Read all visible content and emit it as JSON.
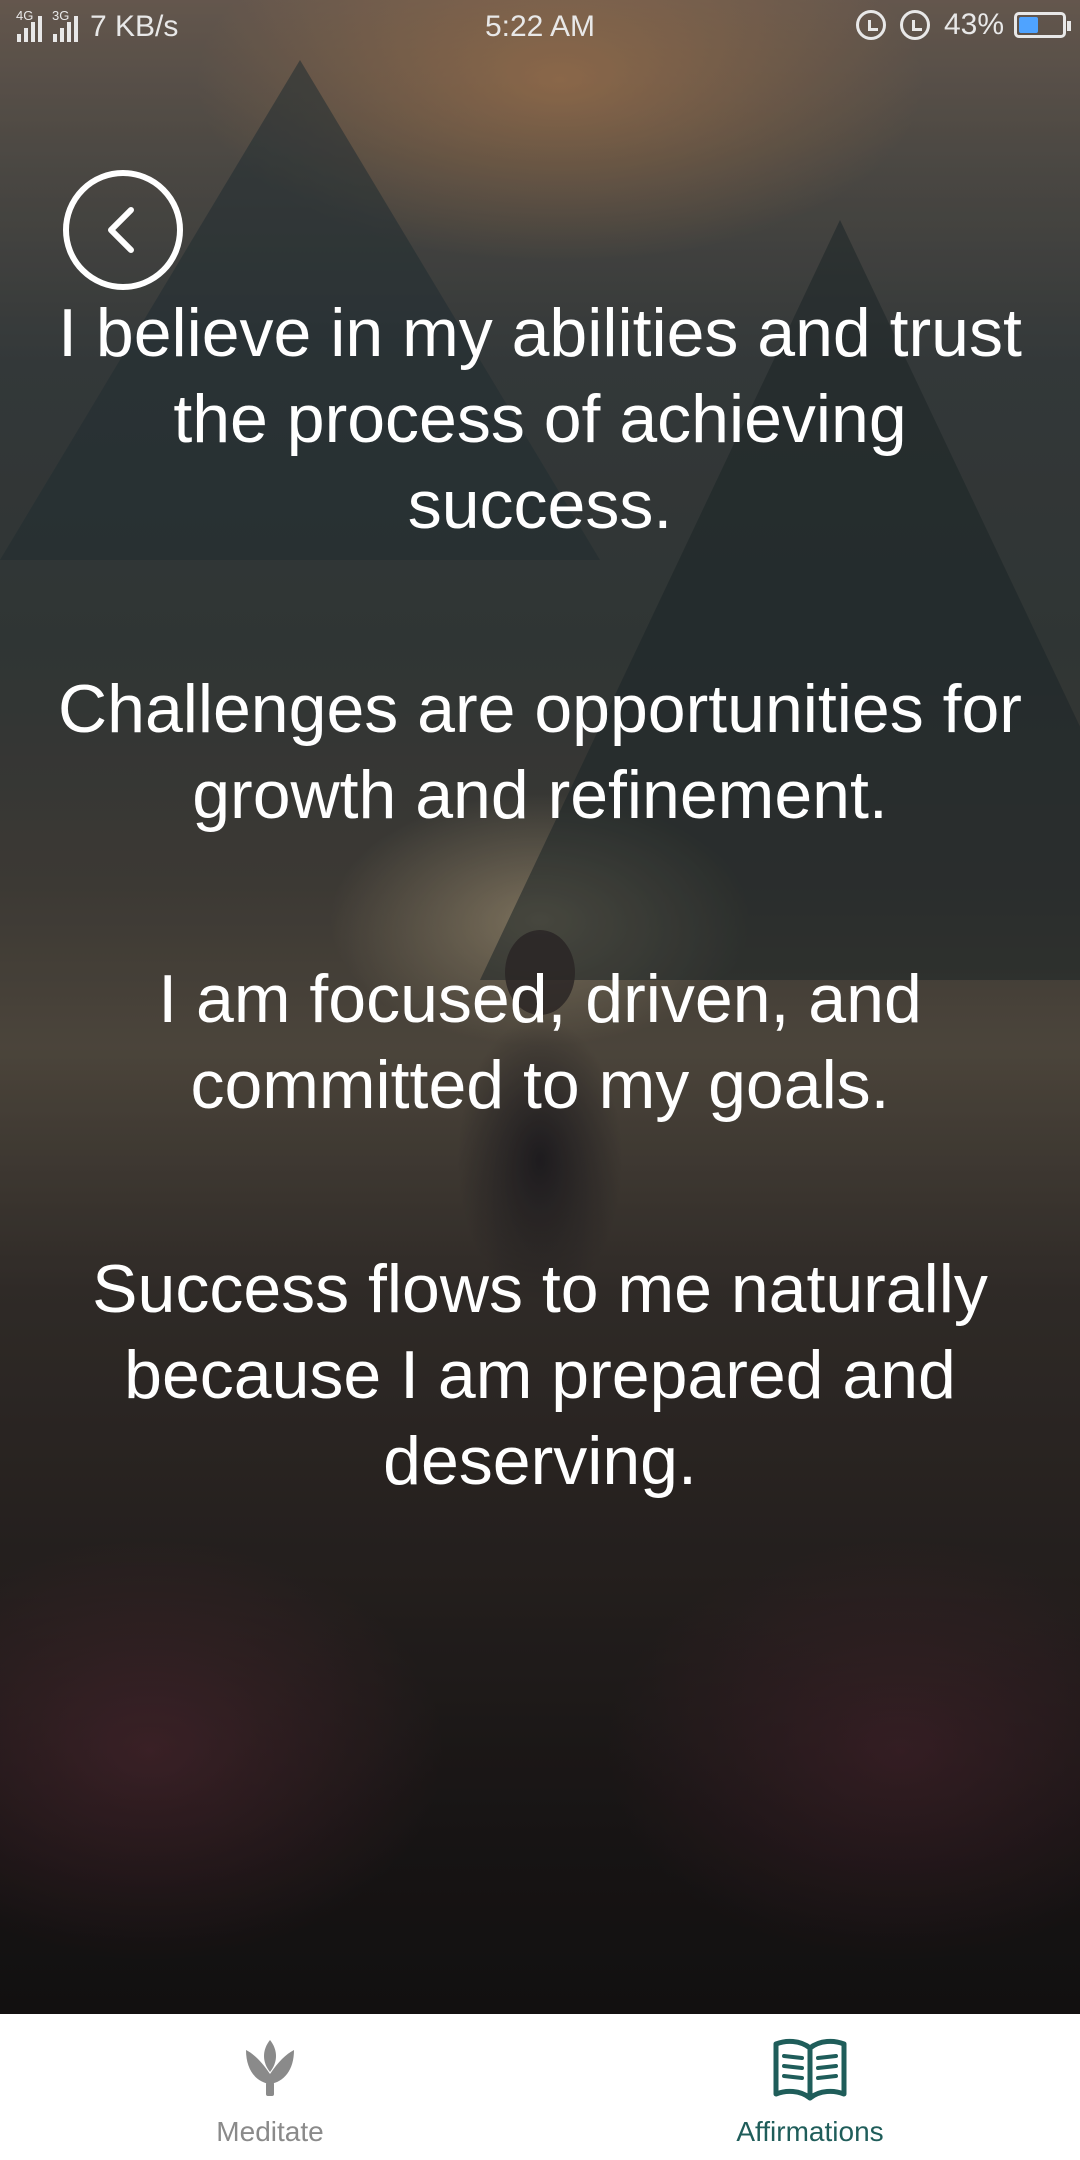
{
  "status_bar": {
    "network_1": "4G",
    "network_2": "3G",
    "speed": "7 KB/s",
    "time": "5:22 AM",
    "battery": "43%",
    "battery_level": 0.43,
    "icons": [
      "signal-icon",
      "signal-icon",
      "lock-rotation-icon",
      "alarm-icon",
      "battery-charging-icon"
    ]
  },
  "back_button": {
    "icon": "chevron-left-icon"
  },
  "affirmations": [
    "I believe in my abilities and trust the process of achieving success.",
    "Challenges are opportunities for growth and refinement.",
    "I am focused, driven, and committed to my goals.",
    "Success flows to me naturally because I am prepared and deserving."
  ],
  "bottom_nav": {
    "items": [
      {
        "label": "Meditate",
        "icon": "lotus-icon",
        "active": false
      },
      {
        "label": "Affirmations",
        "icon": "open-book-icon",
        "active": true
      }
    ]
  },
  "colors": {
    "active_tab": "#1f5d5a",
    "inactive_tab": "#8a8a8a",
    "battery_fill": "#4fa3ff"
  }
}
